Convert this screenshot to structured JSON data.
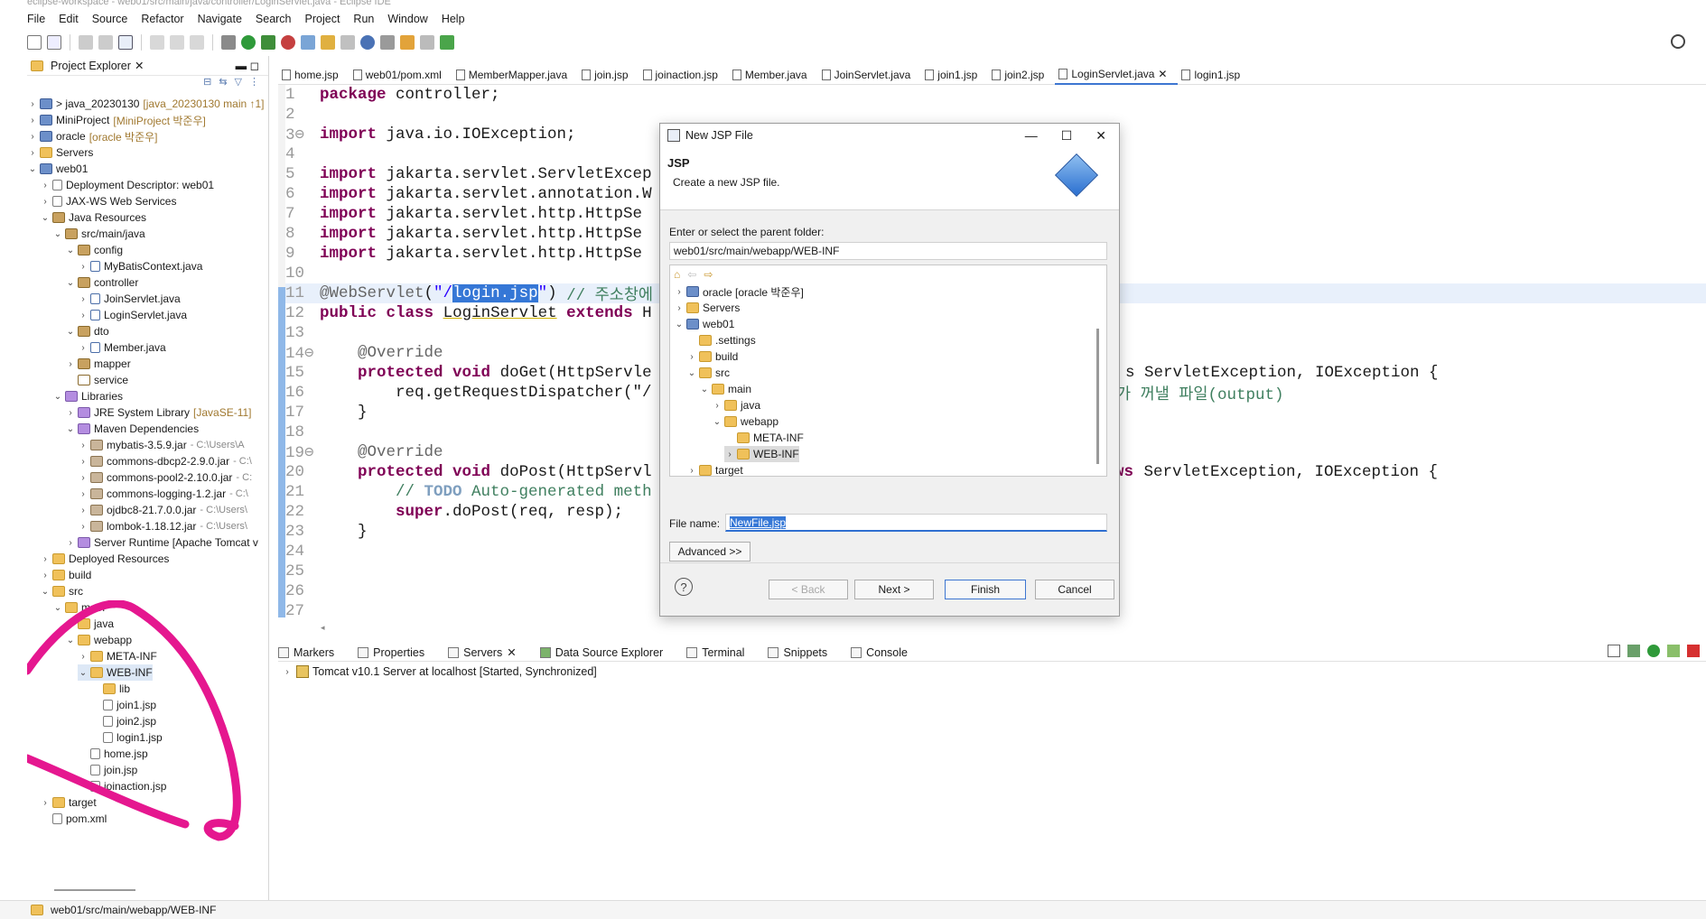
{
  "window": {
    "title": "eclipse-workspace - web01/src/main/java/controller/LoginServlet.java - Eclipse IDE"
  },
  "menu": [
    "File",
    "Edit",
    "Source",
    "Refactor",
    "Navigate",
    "Search",
    "Project",
    "Run",
    "Window",
    "Help"
  ],
  "explorer": {
    "title": "Project Explorer",
    "rows": [
      {
        "label": "> java_20230130",
        "deco": "[java_20230130 main ↑1]"
      },
      {
        "label": "MiniProject",
        "deco": "[MiniProject 박준우]"
      },
      {
        "label": "oracle",
        "deco": "[oracle 박준우]"
      },
      {
        "label": "Servers",
        "deco": ""
      },
      {
        "label": "web01",
        "deco": ""
      },
      {
        "label": "Deployment Descriptor: web01",
        "deco": ""
      },
      {
        "label": "JAX-WS Web Services",
        "deco": ""
      },
      {
        "label": "Java Resources",
        "deco": ""
      },
      {
        "label": "src/main/java",
        "deco": ""
      },
      {
        "label": "config",
        "deco": ""
      },
      {
        "label": "MyBatisContext.java",
        "deco": ""
      },
      {
        "label": "controller",
        "deco": ""
      },
      {
        "label": "JoinServlet.java",
        "deco": ""
      },
      {
        "label": "LoginServlet.java",
        "deco": ""
      },
      {
        "label": "dto",
        "deco": ""
      },
      {
        "label": "Member.java",
        "deco": ""
      },
      {
        "label": "mapper",
        "deco": ""
      },
      {
        "label": "service",
        "deco": ""
      },
      {
        "label": "Libraries",
        "deco": ""
      },
      {
        "label": "JRE System Library",
        "deco": "[JavaSE-11]"
      },
      {
        "label": "Maven Dependencies",
        "deco": ""
      },
      {
        "label": "mybatis-3.5.9.jar",
        "deco": "- C:\\Users\\A"
      },
      {
        "label": "commons-dbcp2-2.9.0.jar",
        "deco": "- C:\\"
      },
      {
        "label": "commons-pool2-2.10.0.jar",
        "deco": "- C:"
      },
      {
        "label": "commons-logging-1.2.jar",
        "deco": "- C:\\"
      },
      {
        "label": "ojdbc8-21.7.0.0.jar",
        "deco": "- C:\\Users\\"
      },
      {
        "label": "lombok-1.18.12.jar",
        "deco": "- C:\\Users\\"
      },
      {
        "label": "Server Runtime [Apache Tomcat v",
        "deco": ""
      },
      {
        "label": "Deployed Resources",
        "deco": ""
      },
      {
        "label": "build",
        "deco": ""
      },
      {
        "label": "src",
        "deco": ""
      },
      {
        "label": "main",
        "deco": ""
      },
      {
        "label": "java",
        "deco": ""
      },
      {
        "label": "webapp",
        "deco": ""
      },
      {
        "label": "META-INF",
        "deco": ""
      },
      {
        "label": "WEB-INF",
        "deco": ""
      },
      {
        "label": "lib",
        "deco": ""
      },
      {
        "label": "join1.jsp",
        "deco": ""
      },
      {
        "label": "join2.jsp",
        "deco": ""
      },
      {
        "label": "login1.jsp",
        "deco": ""
      },
      {
        "label": "home.jsp",
        "deco": ""
      },
      {
        "label": "join.jsp",
        "deco": ""
      },
      {
        "label": "joinaction.jsp",
        "deco": ""
      },
      {
        "label": "target",
        "deco": ""
      },
      {
        "label": "pom.xml",
        "deco": ""
      }
    ]
  },
  "editor": {
    "tabs": [
      "home.jsp",
      "web01/pom.xml",
      "MemberMapper.java",
      "join.jsp",
      "joinaction.jsp",
      "Member.java",
      "JoinServlet.java",
      "join1.jsp",
      "join2.jsp",
      "LoginServlet.java",
      "login1.jsp"
    ],
    "active_tab": "LoginServlet.java",
    "line_numbers": [
      "1",
      "2",
      "3⊖",
      "4",
      "5",
      "6",
      "7",
      "8",
      "9",
      "10",
      "11",
      "12",
      "13",
      "14⊖",
      "15",
      "16",
      "17",
      "18",
      "19⊖",
      "20",
      "21",
      "22",
      "23",
      "24",
      "25",
      "26",
      "27"
    ],
    "code": {
      "l1_kw": "package",
      "l1_rest": " controller;",
      "l3_kw": "import",
      "l3_rest": " java.io.IOException;",
      "l5_kw": "import",
      "l5_rest": " jakarta.servlet.ServletExcep",
      "l6_kw": "import",
      "l6_rest": " jakarta.servlet.annotation.W",
      "l7_kw": "import",
      "l7_rest": " jakarta.servlet.http.HttpSe",
      "l8_kw": "import",
      "l8_rest": " jakarta.servlet.http.HttpSe",
      "l9_kw": "import",
      "l9_rest": " jakarta.servlet.http.HttpSe",
      "l11_ann": "@WebServlet",
      "l11_p1": "(",
      "l11_str1": "\"/",
      "l11_sel": "login.jsp",
      "l11_str2": "\"",
      "l11_p2": ") ",
      "l11_cmt": "// 주소창에",
      "l12_kw1": "public",
      "l12_kw2": "class",
      "l12_name": "LoginServlet",
      "l12_kw3": "extends",
      "l12_rest": " H",
      "l14_ann": "@Override",
      "l15_kw1": "protected",
      "l15_kw2": "void",
      "l15_rest": " doGet(HttpServle",
      "l15_right": "s ServletException, IOException {",
      "l16_rest": "req.getRequestDispatcher(\"/",
      "l16_right": "가 꺼낼 파일(output)",
      "l17": "}",
      "l19_ann": "@Override",
      "l20_kw1": "protected",
      "l20_kw2": "void",
      "l20_rest": " doPost(HttpServl",
      "l20_right_kw": "ws",
      "l20_right": " ServletException, IOException {",
      "l21_cmt1": "// ",
      "l21_todo": "TODO",
      "l21_cmt2": " Auto-generated meth",
      "l22_kw": "super",
      "l22_rest": ".doPost(req, resp);",
      "l23": "}"
    }
  },
  "bottom": {
    "tabs": [
      "Markers",
      "Properties",
      "Servers",
      "Data Source Explorer",
      "Terminal",
      "Snippets",
      "Console"
    ],
    "server_entry": "Tomcat v10.1 Server at localhost  [Started, Synchronized]"
  },
  "status": {
    "path": "web01/src/main/webapp/WEB-INF"
  },
  "dialog": {
    "title": "New JSP File",
    "heading": "JSP",
    "description": "Create a new JSP file.",
    "parent_label": "Enter or select the parent folder:",
    "parent_value": "web01/src/main/webapp/WEB-INF",
    "tree": [
      {
        "label": "oracle [oracle 박준우]"
      },
      {
        "label": "Servers"
      },
      {
        "label": "web01"
      },
      {
        "label": ".settings"
      },
      {
        "label": "build"
      },
      {
        "label": "src"
      },
      {
        "label": "main"
      },
      {
        "label": "java"
      },
      {
        "label": "webapp"
      },
      {
        "label": "META-INF"
      },
      {
        "label": "WEB-INF"
      },
      {
        "label": "target"
      }
    ],
    "filename_label": "File name:",
    "filename_value": "NewFile.jsp",
    "advanced": "Advanced >>",
    "back": "< Back",
    "next": "Next >",
    "finish": "Finish",
    "cancel": "Cancel",
    "help": "?"
  },
  "colors": {
    "annotation": "#e5178f",
    "keyword": "#7f0055",
    "string": "#2a00ff",
    "comment": "#3f7f5f",
    "selection": "#3577d6"
  }
}
